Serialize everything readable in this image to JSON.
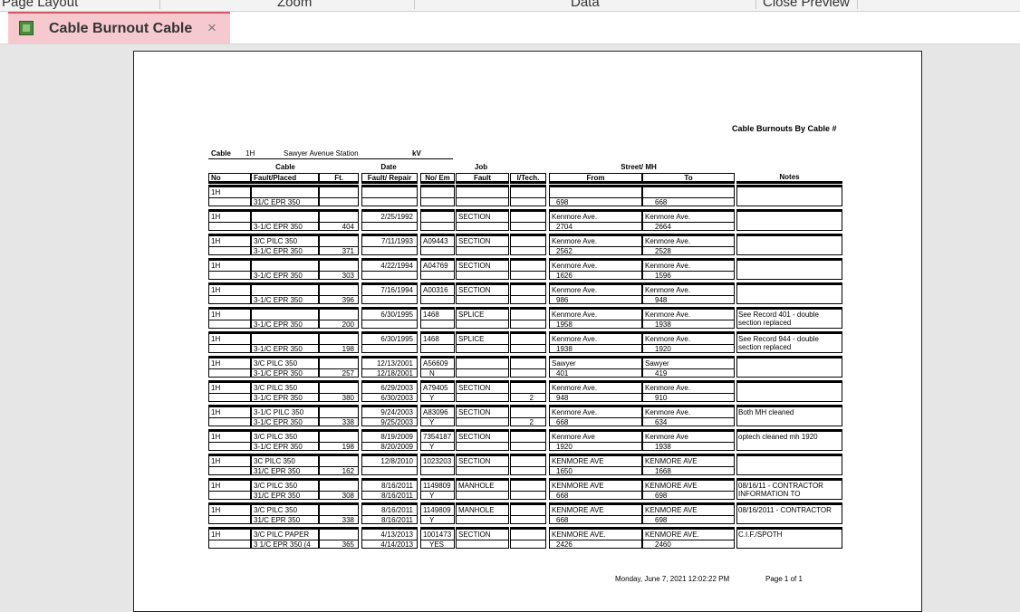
{
  "ribbon": {
    "groups": [
      "Page Layout",
      "Zoom",
      "Data",
      "Close Preview"
    ]
  },
  "tab": {
    "title": "Cable Burnout Cable",
    "close": "×"
  },
  "report": {
    "title": "Cable Burnouts By Cable #",
    "header": {
      "cable_label": "Cable",
      "cable_value": "1H",
      "station": "Sawyer Avenue Station",
      "kv_label": "kV"
    },
    "groups": {
      "cable": "Cable",
      "date": "Date",
      "job": "Job",
      "street": "Street/ MH"
    },
    "columns": {
      "no": "No",
      "fault_placed": "Fault/Placed",
      "ft": "Ft.",
      "fault_repair": "Fault/ Repair",
      "no_em": "No/ Em",
      "fault": "Fault",
      "itech": "I/Tech.",
      "from": "From",
      "to": "To",
      "notes": "Notes"
    },
    "rows": [
      {
        "no": "1H",
        "fault": "",
        "placed": "31/C EPR 350",
        "ft": "",
        "fault_date": "",
        "repair_date": "",
        "job_no": "",
        "em": "",
        "job_fault": "",
        "itech": "",
        "from_street": "",
        "from_mh": "698",
        "to_street": "",
        "to_mh": "668",
        "notes": ""
      },
      {
        "no": "1H",
        "fault": "",
        "placed": "3-1/C EPR 350",
        "ft": "404",
        "fault_date": "2/25/1992",
        "repair_date": "",
        "job_no": "",
        "em": "",
        "job_fault": "SECTION",
        "itech": "",
        "from_street": "Kenmore Ave.",
        "from_mh": "2704",
        "to_street": "Kenmore Ave.",
        "to_mh": "2664",
        "notes": ""
      },
      {
        "no": "1H",
        "fault": "3/C PILC 350",
        "placed": "3-1/C EPR 350",
        "ft": "371",
        "fault_date": "7/11/1993",
        "repair_date": "",
        "job_no": "A09443",
        "em": "",
        "job_fault": "SECTION",
        "itech": "",
        "from_street": "Kenmore Ave.",
        "from_mh": "2562",
        "to_street": "Kenmore Ave.",
        "to_mh": "2528",
        "notes": ""
      },
      {
        "no": "1H",
        "fault": "",
        "placed": "3-1/C EPR 350",
        "ft": "303",
        "fault_date": "4/22/1994",
        "repair_date": "",
        "job_no": "A04769",
        "em": "",
        "job_fault": "SECTION",
        "itech": "",
        "from_street": "Kenmore Ave.",
        "from_mh": "1626",
        "to_street": "Kenmore Ave.",
        "to_mh": "1596",
        "notes": ""
      },
      {
        "no": "1H",
        "fault": "",
        "placed": "3-1/C EPR 350",
        "ft": "396",
        "fault_date": "7/16/1994",
        "repair_date": "",
        "job_no": "A00316",
        "em": "",
        "job_fault": "SECTION",
        "itech": "",
        "from_street": "Kenmore Ave.",
        "from_mh": "986",
        "to_street": "Kenmore Ave.",
        "to_mh": "948",
        "notes": ""
      },
      {
        "no": "1H",
        "fault": "",
        "placed": "3-1/C EPR 350",
        "ft": "200",
        "fault_date": "6/30/1995",
        "repair_date": "",
        "job_no": "1468",
        "em": "",
        "job_fault": "SPLICE",
        "itech": "",
        "from_street": "Kenmore Ave.",
        "from_mh": "1958",
        "to_street": "Kenmore Ave.",
        "to_mh": "1938",
        "notes": "See Record 401 - double section replaced"
      },
      {
        "no": "1H",
        "fault": "",
        "placed": "3-1/C EPR 350",
        "ft": "198",
        "fault_date": "6/30/1995",
        "repair_date": "",
        "job_no": "1468",
        "em": "",
        "job_fault": "SPLICE",
        "itech": "",
        "from_street": "Kenmore Ave.",
        "from_mh": "1938",
        "to_street": "Kenmore Ave.",
        "to_mh": "1920",
        "notes": "See Record 944 - double section replaced"
      },
      {
        "no": "1H",
        "fault": "3/C PILC 350",
        "placed": "3-1/C EPR 350",
        "ft": "257",
        "fault_date": "12/13/2001",
        "repair_date": "12/18/2001",
        "job_no": "A56609",
        "em": "N",
        "job_fault": "",
        "itech": "",
        "from_street": "Sawyer",
        "from_mh": "401",
        "to_street": "Sawyer",
        "to_mh": "419",
        "notes": ""
      },
      {
        "no": "1H",
        "fault": "3/C PILC 350",
        "placed": "3-1/C EPR 350",
        "ft": "380",
        "fault_date": "6/29/2003",
        "repair_date": "6/30/2003",
        "job_no": "A79405",
        "em": "Y",
        "job_fault": "SECTION",
        "itech": "2",
        "from_street": "Kenmore Ave.",
        "from_mh": "948",
        "to_street": "Kenmore Ave.",
        "to_mh": "910",
        "notes": ""
      },
      {
        "no": "1H",
        "fault": "3-1/C PILC 350",
        "placed": "3-1/C EPR 350",
        "ft": "338",
        "fault_date": "9/24/2003",
        "repair_date": "9/25/2003",
        "job_no": "A83096",
        "em": "Y",
        "job_fault": "SECTION",
        "itech": "2",
        "from_street": "Kenmore Ave.",
        "from_mh": "668",
        "to_street": "Kenmore Ave.",
        "to_mh": "634",
        "notes": "Both MH cleaned"
      },
      {
        "no": "1H",
        "fault": "3/C PILC 350",
        "placed": "3-1/C EPR 350",
        "ft": "198",
        "fault_date": "8/19/2009",
        "repair_date": "8/20/2009",
        "job_no": "7354187",
        "em": "Y",
        "job_fault": "SECTION",
        "itech": "",
        "from_street": "Kenmore Ave",
        "from_mh": "1920",
        "to_street": "Kenmore Ave",
        "to_mh": "1938",
        "notes": "optech cleaned mh 1920"
      },
      {
        "no": "1H",
        "fault": "3C PILC 350",
        "placed": "31/C EPR 350",
        "ft": "162",
        "fault_date": "12/8/2010",
        "repair_date": "",
        "job_no": "1023203",
        "em": "",
        "job_fault": "SECTION",
        "itech": "",
        "from_street": "KENMORE AVE",
        "from_mh": "1650",
        "to_street": "KENMORE AVE",
        "to_mh": "1668",
        "notes": ""
      },
      {
        "no": "1H",
        "fault": "3/C PILC 350",
        "placed": "31/C EPR 350",
        "ft": "308",
        "fault_date": "8/16/2011",
        "repair_date": "8/16/2011",
        "job_no": "1149809",
        "em": "Y",
        "job_fault": "MANHOLE",
        "itech": "",
        "from_street": "KENMORE AVE",
        "from_mh": "668",
        "to_street": "KENMORE AVE",
        "to_mh": "698",
        "notes": "08/16/11 - CONTRACTOR INFORMATION TO"
      },
      {
        "no": "1H",
        "fault": "3/C PILC 350",
        "placed": "31/C EPR 350",
        "ft": "338",
        "fault_date": "8/16/2011",
        "repair_date": "8/16/2011",
        "job_no": "1149809",
        "em": "Y",
        "job_fault": "MANHOLE",
        "itech": "",
        "from_street": "KENMORE AVE",
        "from_mh": "668",
        "to_street": "KENMORE AVE",
        "to_mh": "698",
        "notes": "08/16/2011 - CONTRACTOR"
      },
      {
        "no": "1H",
        "fault": "3/C PILC PAPER",
        "placed": "3 1/C EPR 350 (4",
        "ft": "365",
        "fault_date": "4/13/2013",
        "repair_date": "4/14/2013",
        "job_no": "1001473",
        "em": "YES",
        "job_fault": "SECTION",
        "itech": "",
        "from_street": "KENMORE AVE.",
        "from_mh": "2426",
        "to_street": "KENMORE AVE.",
        "to_mh": "2460",
        "notes": "C.I.F./SPOTH"
      }
    ],
    "footer": {
      "date": "Monday, June 7, 2021 12:02:22 PM",
      "page": "Page 1 of 1"
    }
  }
}
